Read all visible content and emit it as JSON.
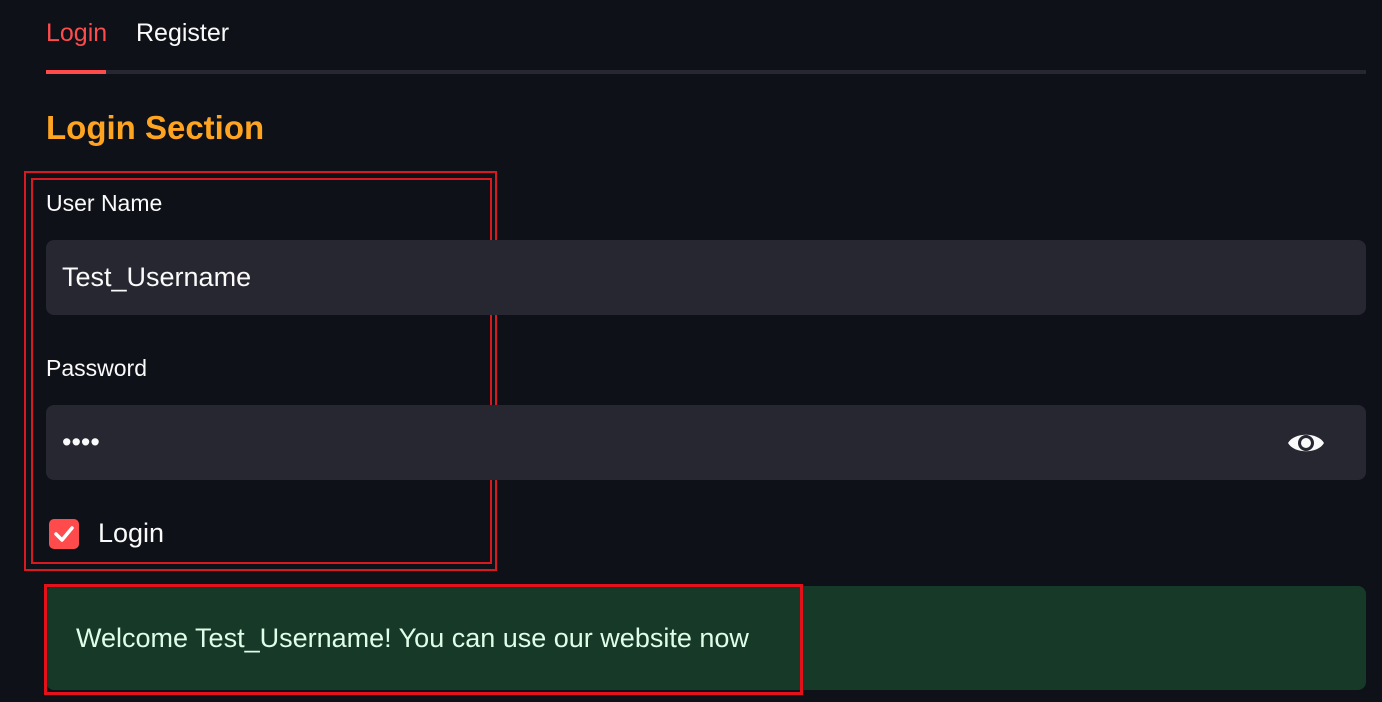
{
  "tabs": [
    {
      "label": "Login",
      "active": true
    },
    {
      "label": "Register",
      "active": false
    }
  ],
  "section_title": "Login Section",
  "form": {
    "username_label": "User Name",
    "username_value": "Test_Username",
    "password_label": "Password",
    "password_masked": "••••",
    "password_toggle_icon": "eye-icon",
    "checkbox_label": "Login",
    "checkbox_checked": true
  },
  "alert": {
    "message": "Welcome Test_Username! You can use our website now"
  },
  "colors": {
    "background": "#0e1117",
    "accent": "#ff4b4b",
    "title": "#ffa421",
    "input_bg": "#262730",
    "success_bg": "#173928",
    "success_text": "#dffde9",
    "annotation_outline": "#e3121a"
  }
}
